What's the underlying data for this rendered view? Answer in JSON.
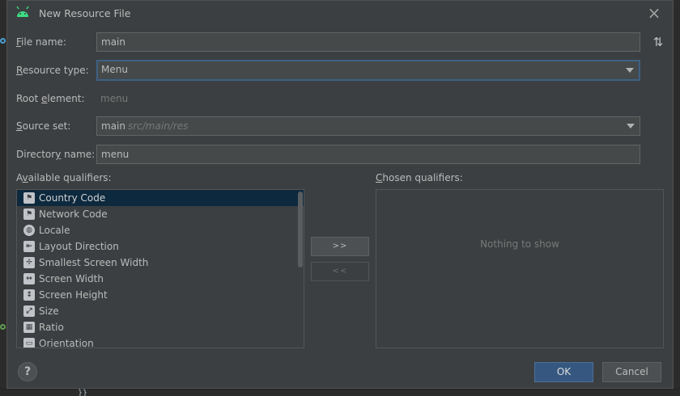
{
  "dialog": {
    "title": "New Resource File",
    "icon": "android-icon"
  },
  "form": {
    "file_name": {
      "label_mnemonic": "F",
      "label_rest": "ile name:",
      "value": "main"
    },
    "resource_type": {
      "label_mnemonic": "R",
      "label_rest": "esource type:",
      "value": "Menu"
    },
    "root_element": {
      "label_pre": "Root ",
      "label_mnemonic": "e",
      "label_rest": "lement:",
      "value": "menu"
    },
    "source_set": {
      "label_mnemonic": "S",
      "label_rest": "ource set:",
      "value": "main",
      "hint": "src/main/res"
    },
    "directory_name": {
      "label_pre": "Director",
      "label_mnemonic": "y",
      "label_rest": " name:",
      "value": "menu"
    }
  },
  "available": {
    "label_pre": "A",
    "label_mnemonic": "v",
    "label_rest": "ailable qualifiers:",
    "items": [
      {
        "label": "Country Code",
        "icon": "country-code-icon",
        "glyph": "⚑"
      },
      {
        "label": "Network Code",
        "icon": "network-code-icon",
        "glyph": "⚑"
      },
      {
        "label": "Locale",
        "icon": "globe-icon",
        "glyph": "◍"
      },
      {
        "label": "Layout Direction",
        "icon": "layout-direction-icon",
        "glyph": "⇤"
      },
      {
        "label": "Smallest Screen Width",
        "icon": "smallest-width-icon",
        "glyph": "✢"
      },
      {
        "label": "Screen Width",
        "icon": "screen-width-icon",
        "glyph": "↔"
      },
      {
        "label": "Screen Height",
        "icon": "screen-height-icon",
        "glyph": "↕"
      },
      {
        "label": "Size",
        "icon": "size-icon",
        "glyph": "⤢"
      },
      {
        "label": "Ratio",
        "icon": "ratio-icon",
        "glyph": "▦"
      },
      {
        "label": "Orientation",
        "icon": "orientation-icon",
        "glyph": "▭"
      }
    ]
  },
  "chosen": {
    "label_mnemonic": "C",
    "label_rest": "hosen qualifiers:",
    "empty_text": "Nothing to show"
  },
  "buttons": {
    "add": ">>",
    "remove": "<<",
    "ok": "OK",
    "cancel": "Cancel",
    "help": "?"
  },
  "background": {
    "code_fragment": "}}"
  },
  "colors": {
    "dialog_bg": "#3c3f41",
    "field_bg": "#45494a",
    "focus_border": "#3d6185",
    "selection": "#0d293e",
    "primary_button": "#365880",
    "android_green": "#3ddc84"
  }
}
